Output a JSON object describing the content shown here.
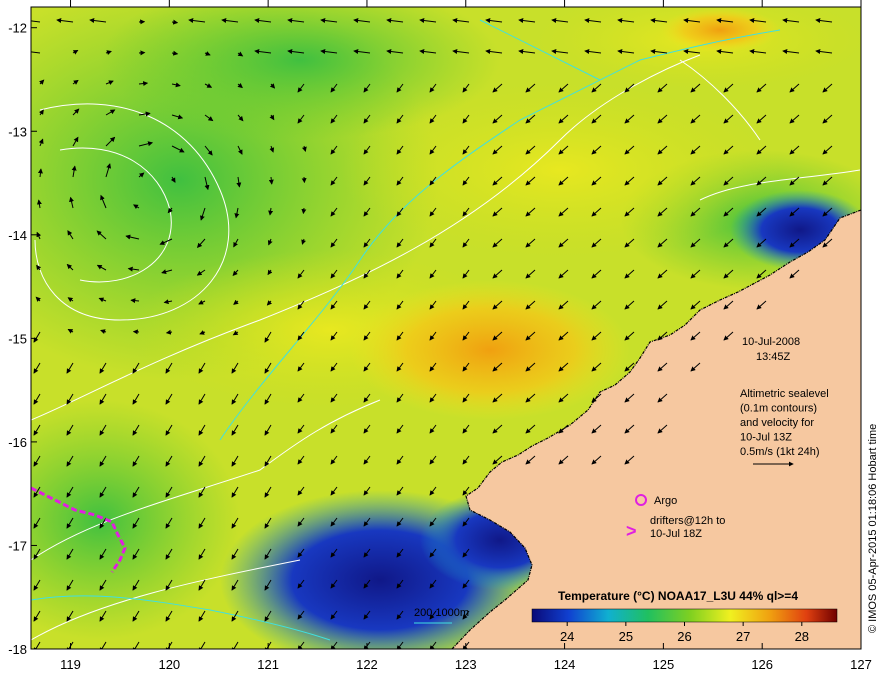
{
  "map": {
    "lon_ticks": [
      "119",
      "120",
      "121",
      "122",
      "123",
      "124",
      "125",
      "126",
      "127"
    ],
    "lat_ticks": [
      "-12",
      "-13",
      "-14",
      "-15",
      "-16",
      "-17",
      "-18"
    ],
    "lon_range": [
      118.6,
      127
    ],
    "lat_range": [
      -18,
      -11.8
    ]
  },
  "annotations": {
    "date": "10-Jul-2008",
    "time": "13:45Z",
    "legend_lines": [
      "Altimetric sealevel",
      "(0.1m contours)",
      "and velocity for",
      "10-Jul 13Z",
      "0.5m/s (1kt 24h)"
    ],
    "argo_label": "Argo",
    "drifter_line1": "drifters@12h to",
    "drifter_line2": "10-Jul 18Z",
    "bathy_label": "200  1000m"
  },
  "colorbar": {
    "title": "Temperature (°C) NOAA17_L3U 44% ql>=4",
    "ticks": [
      "24",
      "25",
      "26",
      "27",
      "28"
    ],
    "range": [
      23.4,
      28.6
    ]
  },
  "credit": "© IMOS 05-Apr-2015 01:18:06 Hobart time",
  "colors": {
    "land": "#f6c8a0",
    "warm": "#f2a010",
    "cold": "#12208a",
    "drifter": "#e020e0",
    "contour": "#ffffff",
    "bathy": "#40e0e0"
  }
}
